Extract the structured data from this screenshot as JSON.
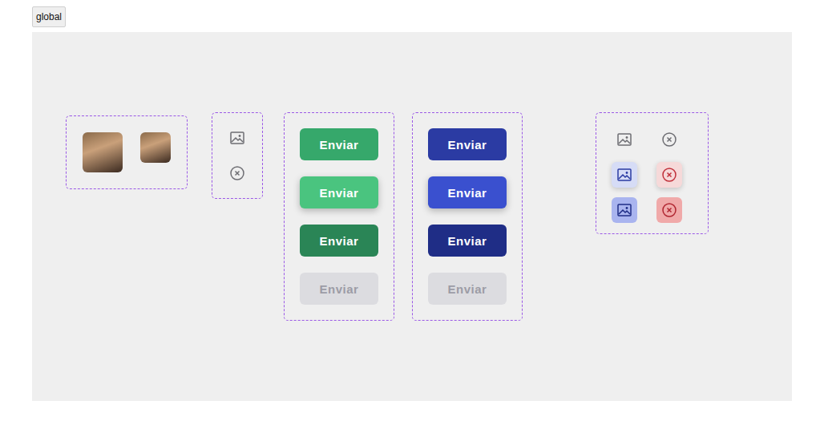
{
  "tag": {
    "label": "global"
  },
  "avatars": [
    {
      "kind": "large"
    },
    {
      "kind": "small"
    }
  ],
  "icons": [
    {
      "kind": "image"
    },
    {
      "kind": "close"
    }
  ],
  "button_groups": [
    {
      "buttons": [
        {
          "label": "Enviar",
          "kind": "default",
          "disabled": false,
          "color": "#36a86b"
        },
        {
          "label": "Enviar",
          "kind": "hover",
          "disabled": false,
          "color": "#4ac47f"
        },
        {
          "label": "Enviar",
          "kind": "pressed",
          "disabled": false,
          "color": "#2a8556"
        },
        {
          "label": "Enviar",
          "kind": "disabled",
          "disabled": true,
          "color": "#dcdce0"
        }
      ]
    },
    {
      "buttons": [
        {
          "label": "Enviar",
          "kind": "default",
          "disabled": false,
          "color": "#2b3ba3"
        },
        {
          "label": "Enviar",
          "kind": "hover",
          "disabled": false,
          "color": "#3a50cf"
        },
        {
          "label": "Enviar",
          "kind": "pressed",
          "disabled": false,
          "color": "#1f2d86"
        },
        {
          "label": "Enviar",
          "kind": "disabled",
          "disabled": true,
          "color": "#dcdce0"
        }
      ]
    }
  ],
  "icon_button_rows": [
    {
      "kind": "default",
      "items": [
        {
          "icon": "image"
        },
        {
          "icon": "close"
        }
      ]
    },
    {
      "kind": "hover",
      "items": [
        {
          "icon": "image"
        },
        {
          "icon": "close"
        }
      ]
    },
    {
      "kind": "pressed",
      "items": [
        {
          "icon": "image"
        },
        {
          "icon": "close"
        }
      ]
    }
  ]
}
